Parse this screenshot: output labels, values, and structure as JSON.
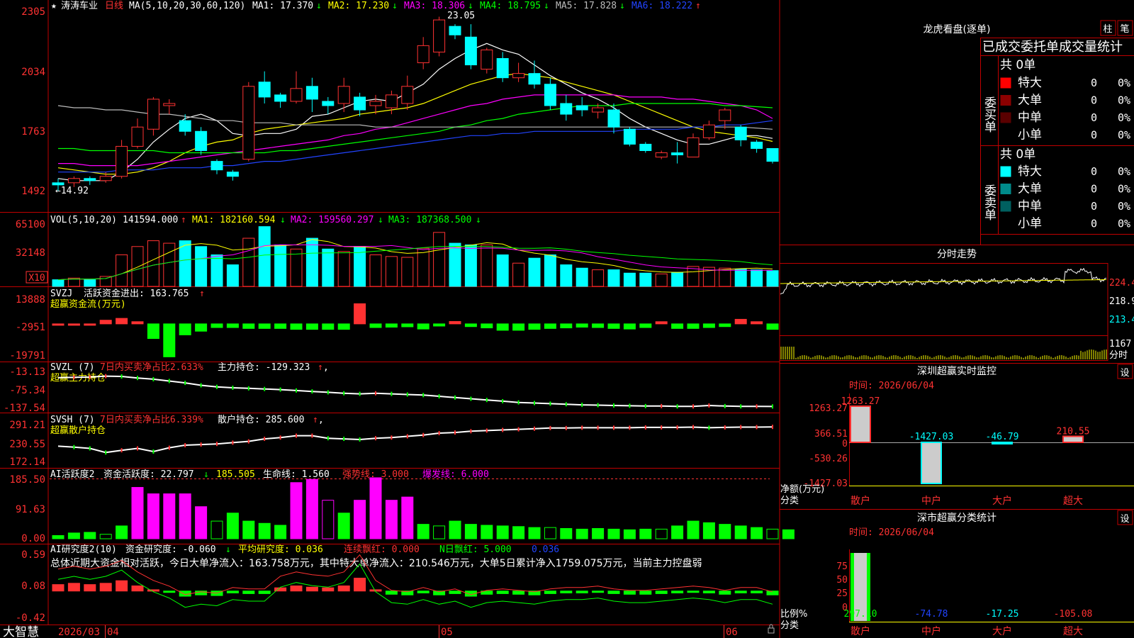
{
  "stock": {
    "name": "涛涛车业",
    "period": "日线"
  },
  "colors": {
    "up": "#ff3232",
    "down": "#00ffff",
    "ma1": "#ffffff",
    "ma2": "#ffff00",
    "ma3": "#ff00ff",
    "ma4": "#00ff00",
    "ma5": "#bbbbbb",
    "ma6": "#2244ff",
    "panel_red": "#c00000",
    "green_bar": "#00ff00",
    "magenta_bar": "#ff00ff"
  },
  "main": {
    "labels": {
      "ma_def": "MA(5,10,20,30,60,120)",
      "ma1": "MA1: 17.370",
      "ma2": "MA2: 17.230",
      "ma3": "MA3: 18.306",
      "ma4": "MA4: 18.795",
      "ma5": "MA5: 17.828",
      "ma6": "MA6: 18.222"
    },
    "ma_arrows": [
      "↓",
      "↓",
      "↓",
      "↓",
      "↓",
      "↑"
    ],
    "high_label": "23.05",
    "low_label": "←14.92",
    "yticks": [
      "2305",
      "2034",
      "1763",
      "1492"
    ]
  },
  "chart_data": [
    {
      "type": "candlestick",
      "title": "涛涛车业 日线",
      "x_dates": [
        "2026/03",
        "04",
        "05",
        "06"
      ],
      "ylim": [
        14.5,
        23.3
      ],
      "candles": [
        [
          15.3,
          15.2,
          15.5,
          14.92
        ],
        [
          15.3,
          15.5,
          15.6,
          15.1
        ],
        [
          15.5,
          15.4,
          15.6,
          15.2
        ],
        [
          15.4,
          15.6,
          15.8,
          15.3
        ],
        [
          15.6,
          17.0,
          17.3,
          15.5
        ],
        [
          17.0,
          17.9,
          18.3,
          16.9
        ],
        [
          17.8,
          19.2,
          19.3,
          17.5
        ],
        [
          18.9,
          19.0,
          19.2,
          18.5
        ],
        [
          18.2,
          17.7,
          18.5,
          17.5
        ],
        [
          17.7,
          16.8,
          17.9,
          16.6
        ],
        [
          16.3,
          15.9,
          16.4,
          15.7
        ],
        [
          15.8,
          15.6,
          15.9,
          15.4
        ],
        [
          16.4,
          19.8,
          20.0,
          16.3
        ],
        [
          20.0,
          19.3,
          20.5,
          19.0
        ],
        [
          19.4,
          19.1,
          19.5,
          18.8
        ],
        [
          19.1,
          19.7,
          20.5,
          19.0
        ],
        [
          19.8,
          19.2,
          20.2,
          18.6
        ],
        [
          19.1,
          18.9,
          19.3,
          18.5
        ],
        [
          19.0,
          19.8,
          20.2,
          18.6
        ],
        [
          19.3,
          18.7,
          19.5,
          18.4
        ],
        [
          18.9,
          19.1,
          19.4,
          18.5
        ],
        [
          18.8,
          19.4,
          19.6,
          18.5
        ],
        [
          19.0,
          19.8,
          20.3,
          18.7
        ],
        [
          20.9,
          21.7,
          22.1,
          20.6
        ],
        [
          21.4,
          22.9,
          23.05,
          21.2
        ],
        [
          22.6,
          22.2,
          22.7,
          22.0
        ],
        [
          22.1,
          20.8,
          22.7,
          20.6
        ],
        [
          20.6,
          21.5,
          21.6,
          20.4
        ],
        [
          21.1,
          20.2,
          21.4,
          20.0
        ],
        [
          20.2,
          20.4,
          20.9,
          20.0
        ],
        [
          20.4,
          19.9,
          21.0,
          19.7
        ],
        [
          19.9,
          18.9,
          20.2,
          18.7
        ],
        [
          19.0,
          18.5,
          19.4,
          18.2
        ],
        [
          18.9,
          18.7,
          19.3,
          18.4
        ],
        [
          18.6,
          18.8,
          19.0,
          18.3
        ],
        [
          18.7,
          17.9,
          19.0,
          17.6
        ],
        [
          17.8,
          17.1,
          17.9,
          17.0
        ],
        [
          17.1,
          16.8,
          17.2,
          16.7
        ],
        [
          16.5,
          16.7,
          16.8,
          16.4
        ],
        [
          16.7,
          16.6,
          17.2,
          16.2
        ],
        [
          16.5,
          17.4,
          17.6,
          16.5
        ],
        [
          17.4,
          18.0,
          18.2,
          17.3
        ],
        [
          18.2,
          18.7,
          18.8,
          17.8
        ],
        [
          17.9,
          17.3,
          18.0,
          17.0
        ],
        [
          17.2,
          16.9,
          17.3,
          16.7
        ],
        [
          16.9,
          16.3,
          16.9,
          16.2
        ]
      ],
      "series": [
        {
          "name": "MA1",
          "values": [
            15.5,
            15.4,
            15.4,
            15.4,
            15.8,
            16.4,
            17.2,
            17.8,
            18.3,
            18.5,
            18.2,
            17.6,
            17.5,
            17.6,
            17.6,
            17.8,
            18.4,
            18.5,
            18.8,
            19.1,
            19.2,
            19.1,
            19.5,
            19.9,
            20.6,
            21.1,
            21.5,
            21.8,
            21.5,
            21.3,
            20.8,
            20.3,
            19.9,
            19.5,
            19.2,
            18.8,
            18.3,
            17.9,
            17.6,
            17.3,
            17.1,
            17.1,
            17.3,
            17.5,
            17.5,
            17.37
          ]
        },
        {
          "name": "MA2",
          "values": [
            16.0,
            15.9,
            15.8,
            15.7,
            15.7,
            15.8,
            16.0,
            16.3,
            16.7,
            17.0,
            17.2,
            17.3,
            17.6,
            17.8,
            17.9,
            18.0,
            18.1,
            18.2,
            18.3,
            18.5,
            18.6,
            18.7,
            18.8,
            19.0,
            19.3,
            19.6,
            19.9,
            20.1,
            20.3,
            20.4,
            20.3,
            20.2,
            20.0,
            19.8,
            19.6,
            19.4,
            19.1,
            18.8,
            18.5,
            18.2,
            17.9,
            17.7,
            17.6,
            17.5,
            17.4,
            17.23
          ]
        },
        {
          "name": "MA3",
          "values": [
            16.2,
            16.2,
            16.1,
            16.1,
            16.1,
            16.1,
            16.2,
            16.3,
            16.4,
            16.5,
            16.6,
            16.7,
            16.8,
            16.9,
            17.0,
            17.1,
            17.2,
            17.3,
            17.5,
            17.6,
            17.8,
            17.9,
            18.1,
            18.3,
            18.5,
            18.7,
            18.9,
            19.0,
            19.2,
            19.3,
            19.4,
            19.4,
            19.4,
            19.4,
            19.4,
            19.4,
            19.3,
            19.3,
            19.3,
            19.2,
            19.2,
            19.1,
            19.0,
            18.9,
            18.7,
            18.3
          ]
        },
        {
          "name": "MA4",
          "values": [
            16.9,
            16.9,
            16.8,
            16.8,
            16.8,
            16.8,
            16.8,
            16.7,
            16.7,
            16.7,
            16.7,
            16.7,
            16.7,
            16.7,
            16.8,
            16.8,
            16.9,
            17.0,
            17.1,
            17.2,
            17.3,
            17.4,
            17.5,
            17.6,
            17.7,
            17.9,
            18.0,
            18.2,
            18.3,
            18.5,
            18.6,
            18.7,
            18.8,
            18.9,
            18.9,
            18.9,
            19.0,
            19.0,
            19.0,
            19.0,
            19.0,
            19.0,
            18.9,
            18.9,
            18.85,
            18.8
          ]
        },
        {
          "name": "MA5",
          "values": [
            18.9,
            18.8,
            18.8,
            18.7,
            18.7,
            18.6,
            18.5,
            18.5,
            18.4,
            18.3,
            18.2,
            18.2,
            18.1,
            18.1,
            18.1,
            18.0,
            18.0,
            18.0,
            18.0,
            18.0,
            17.9,
            17.9,
            17.9,
            17.9,
            17.9,
            17.9,
            17.9,
            17.9,
            17.9,
            17.9,
            17.9,
            17.9,
            17.9,
            17.9,
            17.9,
            17.9,
            17.9,
            17.9,
            17.9,
            17.9,
            17.9,
            17.9,
            17.9,
            17.9,
            17.85,
            17.8
          ]
        },
        {
          "name": "MA6",
          "values": [
            15.8,
            15.8,
            15.8,
            15.8,
            15.9,
            15.9,
            15.9,
            16.0,
            16.0,
            16.0,
            16.1,
            16.1,
            16.2,
            16.3,
            16.3,
            16.4,
            16.5,
            16.6,
            16.7,
            16.8,
            16.9,
            17.0,
            17.1,
            17.2,
            17.3,
            17.4,
            17.5,
            17.5,
            17.6,
            17.6,
            17.7,
            17.7,
            17.7,
            17.7,
            17.7,
            17.7,
            17.8,
            17.8,
            17.8,
            17.8,
            17.9,
            17.9,
            18.0,
            18.0,
            18.1,
            18.2
          ]
        }
      ]
    },
    {
      "type": "bar",
      "title": "VOL(5,10,20)",
      "ylim": [
        0,
        70000
      ],
      "values": [
        8000,
        10000,
        8000,
        12000,
        38000,
        48000,
        55000,
        52000,
        55000,
        48000,
        38000,
        26000,
        58000,
        72000,
        50000,
        45000,
        58000,
        45000,
        42000,
        48000,
        38000,
        36000,
        35000,
        46000,
        65000,
        52000,
        50000,
        50000,
        38000,
        28000,
        34000,
        38000,
        26000,
        22000,
        20000,
        20000,
        16000,
        16000,
        15000,
        17000,
        24000,
        23000,
        22000,
        21000,
        20000,
        19000
      ]
    },
    {
      "type": "bar",
      "title": "SVZJ 活跃资金进出",
      "ylim": [
        -19791,
        13888
      ],
      "values": [
        0,
        0,
        0,
        2000,
        3000,
        1200,
        -8000,
        -18000,
        -6000,
        -4000,
        -2000,
        -2000,
        -2500,
        -2500,
        -2500,
        -3000,
        -3000,
        -3000,
        -3000,
        11000,
        -2000,
        -1800,
        -1600,
        -2800,
        -1200,
        1300,
        -1500,
        -2200,
        -3500,
        -3500,
        -3000,
        -2500,
        -2200,
        -1800,
        -2000,
        -2500,
        -2800,
        -2000,
        1200,
        -2500,
        -2500,
        -2000,
        -1500,
        2500,
        1200,
        -3000
      ]
    },
    {
      "type": "line",
      "title": "SVZL(7) 主力持仓",
      "ylim": [
        -140,
        -10
      ],
      "values": [
        -35,
        -34,
        -33,
        -30,
        -31,
        -36,
        -40,
        -46,
        -52,
        -60,
        -65,
        -68,
        -70,
        -72,
        -74,
        -77,
        -80,
        -83,
        -86,
        -88,
        -86,
        -88,
        -90,
        -92,
        -96,
        -100,
        -104,
        -108,
        -112,
        -116,
        -118,
        -120,
        -122,
        -124,
        -125,
        -126,
        -127,
        -128,
        -128,
        -129,
        -129,
        -126,
        -128,
        -129,
        -129,
        -129.3
      ]
    },
    {
      "type": "line",
      "title": "SVSH(7) 散户持仓",
      "ylim": [
        170,
        295
      ],
      "values": [
        225,
        222,
        218,
        205,
        212,
        218,
        208,
        220,
        228,
        230,
        232,
        236,
        240,
        248,
        252,
        258,
        258,
        250,
        248,
        246,
        250,
        252,
        256,
        260,
        266,
        268,
        272,
        274,
        276,
        278,
        280,
        282,
        282,
        283,
        283,
        283,
        283,
        284,
        284,
        284,
        285,
        283,
        284,
        285,
        285,
        285.6
      ]
    },
    {
      "type": "bar",
      "title": "AI活跃度2 资金活跃度",
      "ylim": [
        0,
        185.5
      ],
      "values": [
        10,
        18,
        20,
        14,
        40,
        160,
        140,
        140,
        140,
        100,
        55,
        80,
        55,
        48,
        42,
        175,
        185,
        120,
        80,
        120,
        190,
        120,
        130,
        45,
        40,
        55,
        45,
        42,
        40,
        38,
        35,
        35,
        32,
        30,
        32,
        30,
        28,
        30,
        30,
        40,
        55,
        50,
        45,
        40,
        35,
        30,
        28
      ]
    },
    {
      "type": "bar",
      "title": "AI研究度2(10) 资金研究度",
      "ylim": [
        -0.42,
        0.59
      ],
      "values": [
        0.1,
        0.12,
        0.1,
        0.12,
        0.16,
        0.08,
        0.02,
        -0.02,
        -0.08,
        -0.06,
        -0.07,
        -0.03,
        -0.04,
        -0.04,
        0.05,
        0.08,
        0.06,
        0.05,
        0.08,
        0.2,
        0.02,
        -0.05,
        -0.06,
        -0.03,
        -0.06,
        -0.04,
        -0.08,
        -0.05,
        -0.04,
        -0.05,
        -0.06,
        -0.04,
        -0.03,
        -0.03,
        -0.02,
        -0.04,
        -0.05,
        -0.05,
        -0.04,
        -0.03,
        -0.02,
        -0.03,
        -0.05,
        -0.03,
        -0.03,
        -0.06
      ]
    }
  ],
  "vol": {
    "title": "VOL(5,10,20)",
    "value": "141594.000",
    "ma1": "MA1: 182160.594",
    "ma2": "MA2: 159560.297",
    "ma3": "MA3: 187368.500",
    "arrows": [
      "↑",
      "↓",
      "↓",
      "↓"
    ],
    "yticks": [
      "65100",
      "32148"
    ],
    "unit": "X10"
  },
  "svzj": {
    "title": "SVZJ",
    "label": "活跃资金进出: 163.765",
    "arrow": "↑",
    "sub": "超赢资金流(万元)",
    "yticks": [
      "13888",
      "-2951",
      "-19791"
    ]
  },
  "svzl": {
    "title": "SVZL (7)",
    "sub1": "7日内买卖净占比2.633%",
    "label": "主力持仓: -129.323",
    "arrow": "↑",
    "tail": ",",
    "sub": "超赢主力持仓",
    "yticks": [
      "-13.13",
      "-75.34",
      "-137.54"
    ]
  },
  "svsh": {
    "title": "SVSH (7)",
    "sub1": "7日内买卖净占比6.339%",
    "label": "散户持仓: 285.600",
    "arrow": "↑",
    "tail": ",",
    "sub": "超赢散户持仓",
    "yticks": [
      "291.21",
      "230.55",
      "172.14"
    ]
  },
  "ai1": {
    "title": "AI活跃度2",
    "label": "资金活跃度: 22.797",
    "arrow": "↓",
    "v2": "185.505",
    "v3": "生命线: 1.560",
    "v4": "强势线: 3.000",
    "v5": "爆发线: 6.000",
    "yticks": [
      "185.50",
      "91.63",
      "0.00"
    ]
  },
  "ai2": {
    "title": "AI研究度2(10)",
    "label": "资金研究度: -0.060",
    "l2": "平均研究度: 0.036",
    "l3": "连续飘红: 0.000",
    "l4": "N日飘红: 5.000",
    "l5": "0.036",
    "arrow": "↓",
    "comment": "总体近期大资金相对活跃，今日大单净流入：163.758万元，其中特大单净流入：210.546万元，大单5日累计净入1759.075万元，当前主力控盘弱",
    "yticks": [
      "0.59",
      "0.08",
      "-0.42"
    ]
  },
  "footer": {
    "brand": "大智慧",
    "d1": "2026/03",
    "d2": "04",
    "d3": "05",
    "d4": "06"
  },
  "right": {
    "lhb": {
      "title": "龙虎看盘(逐单)",
      "btn1": "柱",
      "btn2": "笔",
      "tab": "已成交委托单成交量统计"
    },
    "buy": {
      "side": "委买单",
      "count": "共 0单",
      "rows": [
        {
          "name": "特大",
          "v": "0",
          "p": "0%",
          "color": "#ff0000"
        },
        {
          "name": "大单",
          "v": "0",
          "p": "0%",
          "color": "#8b0000"
        },
        {
          "name": "中单",
          "v": "0",
          "p": "0%",
          "color": "#5a0000"
        },
        {
          "name": "小单",
          "v": "0",
          "p": "0%",
          "color": "#000000"
        }
      ]
    },
    "sell": {
      "side": "委卖单",
      "count": "共 0单",
      "rows": [
        {
          "name": "特大",
          "v": "0",
          "p": "0%",
          "color": "#00ffff"
        },
        {
          "name": "大单",
          "v": "0",
          "p": "0%",
          "color": "#008b8b"
        },
        {
          "name": "中单",
          "v": "0",
          "p": "0%",
          "color": "#006060"
        },
        {
          "name": "小单",
          "v": "0",
          "p": "0%",
          "color": "#000000"
        }
      ]
    },
    "intraday": {
      "title": "分时走势",
      "yticks": [
        "224.4",
        "218.9",
        "213.4"
      ],
      "vlabel": "1167",
      "vunit": "分时"
    },
    "monitor": {
      "title": "深圳超赢实时监控",
      "set": "设",
      "time": "时间: 2026/06/04",
      "yticks": [
        "1263.27",
        "366.51",
        "0",
        "-530.26",
        "-1427.03"
      ],
      "ylabel": "净额(万元)",
      "xlabel": "分类",
      "cats": [
        "散户",
        "中户",
        "大户",
        "超大"
      ],
      "values": [
        1263.27,
        -1427.03,
        -46.79,
        210.55
      ],
      "labels": [
        "1263.27",
        "-1427.03",
        "-46.79",
        "210.55"
      ]
    },
    "stat": {
      "title": "深市超赢分类统计",
      "set": "设",
      "time": "时间: 2026/06/04",
      "yticks": [
        "75",
        "50",
        "25",
        "0"
      ],
      "ylabel": "比例%",
      "xlabel": "分类",
      "cats": [
        "散户",
        "中户",
        "大户",
        "超大"
      ],
      "values": [
        "297.10",
        "-74.78",
        "-17.25",
        "-105.08"
      ]
    }
  }
}
